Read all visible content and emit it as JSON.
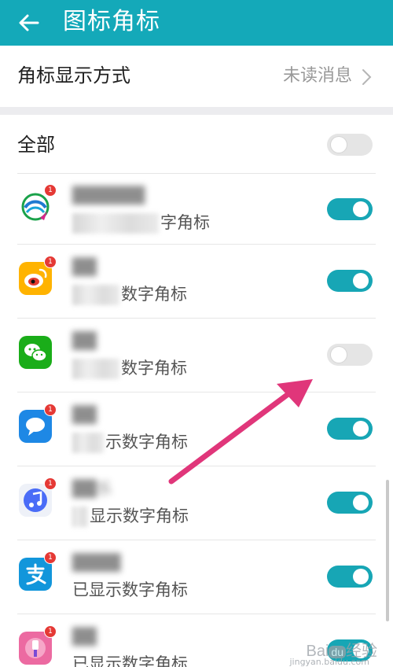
{
  "header": {
    "title": "图标角标",
    "back_icon": "back-arrow-icon",
    "bg_color": "#14a9b9"
  },
  "mode_row": {
    "label": "角标显示方式",
    "value": "未读消息",
    "chevron_icon": "chevron-right-icon"
  },
  "all_row": {
    "label": "全部",
    "toggle_on": false
  },
  "apps": [
    {
      "icon": "china-mobile-icon",
      "badge": "1",
      "name": "██████",
      "status_suffix": "字角标",
      "toggle_on": true
    },
    {
      "icon": "weibo-icon",
      "badge": "1",
      "name": "██",
      "status_suffix": "数字角标",
      "toggle_on": true
    },
    {
      "icon": "wechat-icon",
      "badge": "",
      "name": "██",
      "status_suffix": "数字角标",
      "toggle_on": false
    },
    {
      "icon": "messages-icon",
      "badge": "1",
      "name": "██",
      "status_suffix": "示数字角标",
      "toggle_on": true
    },
    {
      "icon": "music-icon",
      "badge": "1",
      "name": "██乐",
      "status_suffix": "显示数字角标",
      "toggle_on": true
    },
    {
      "icon": "alipay-icon",
      "badge": "1",
      "name": "████",
      "status_suffix": "已显示数字角标",
      "toggle_on": true
    },
    {
      "icon": "theme-brush-icon",
      "badge": "1",
      "name": "██",
      "status_suffix": "已显示数字角标",
      "toggle_on": true
    }
  ],
  "annotation": {
    "arrow_color": "#e0367a",
    "arrow_icon": "pointer-arrow-icon"
  },
  "watermark": {
    "text": "Bai",
    "du": "du",
    "suffix": "经验",
    "url": "jingyan.baidu.com"
  },
  "colors": {
    "accent": "#17a6b5",
    "badge": "#e53935"
  }
}
